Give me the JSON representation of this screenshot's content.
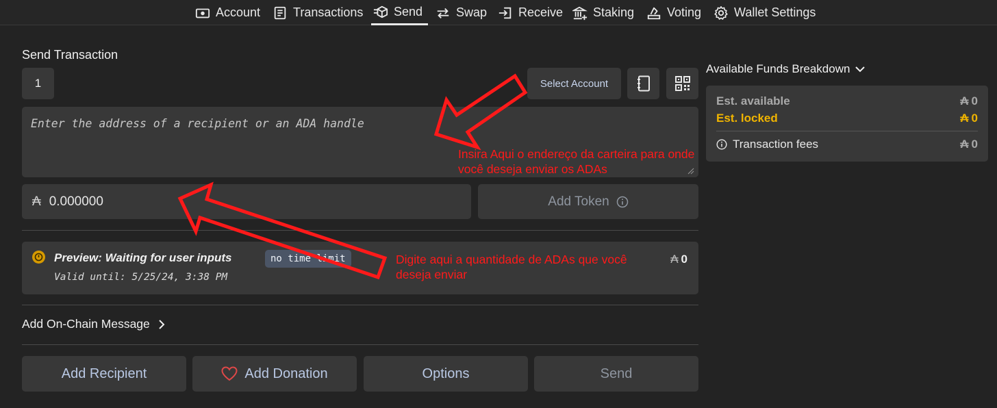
{
  "nav": {
    "items": [
      {
        "label": "Account",
        "icon": "account-icon"
      },
      {
        "label": "Transactions",
        "icon": "transactions-icon"
      },
      {
        "label": "Send",
        "icon": "send-icon",
        "active": true
      },
      {
        "label": "Swap",
        "icon": "swap-icon"
      },
      {
        "label": "Receive",
        "icon": "receive-icon"
      },
      {
        "label": "Staking",
        "icon": "staking-icon"
      },
      {
        "label": "Voting",
        "icon": "voting-icon"
      },
      {
        "label": "Wallet Settings",
        "icon": "gear-icon"
      }
    ]
  },
  "send": {
    "title": "Send Transaction",
    "account_number": "1",
    "select_account_label": "Select Account",
    "address_placeholder": "Enter the address of a recipient or an ADA handle",
    "currency_symbol": "₳",
    "amount_value": "0.000000",
    "add_token_label": "Add Token",
    "preview": {
      "title": "Preview: Waiting for user inputs",
      "badge": "no time limit",
      "valid_until": "Valid until: 5/25/24, 3:38 PM",
      "amount": "0"
    },
    "onchain_message_label": "Add On-Chain Message",
    "buttons": {
      "add_recipient": "Add Recipient",
      "add_donation": "Add Donation",
      "options": "Options",
      "send": "Send"
    }
  },
  "funds": {
    "title": "Available Funds Breakdown",
    "currency_symbol": "₳",
    "est_available_label": "Est. available",
    "est_available_value": "0",
    "est_locked_label": "Est. locked",
    "est_locked_value": "0",
    "fees_label": "Transaction fees",
    "fees_value": "0"
  },
  "annotations": {
    "address_hint": "Insira Aqui o endereço da carteira para onde você deseja enviar os ADAs",
    "amount_hint": "Digite aqui a quantidade de ADAs que você deseja enviar"
  },
  "colors": {
    "background": "#232323",
    "panel": "#383838",
    "locked": "#f0b400",
    "annotation": "#ff1a1a",
    "button_text": "#b9c8e4"
  }
}
